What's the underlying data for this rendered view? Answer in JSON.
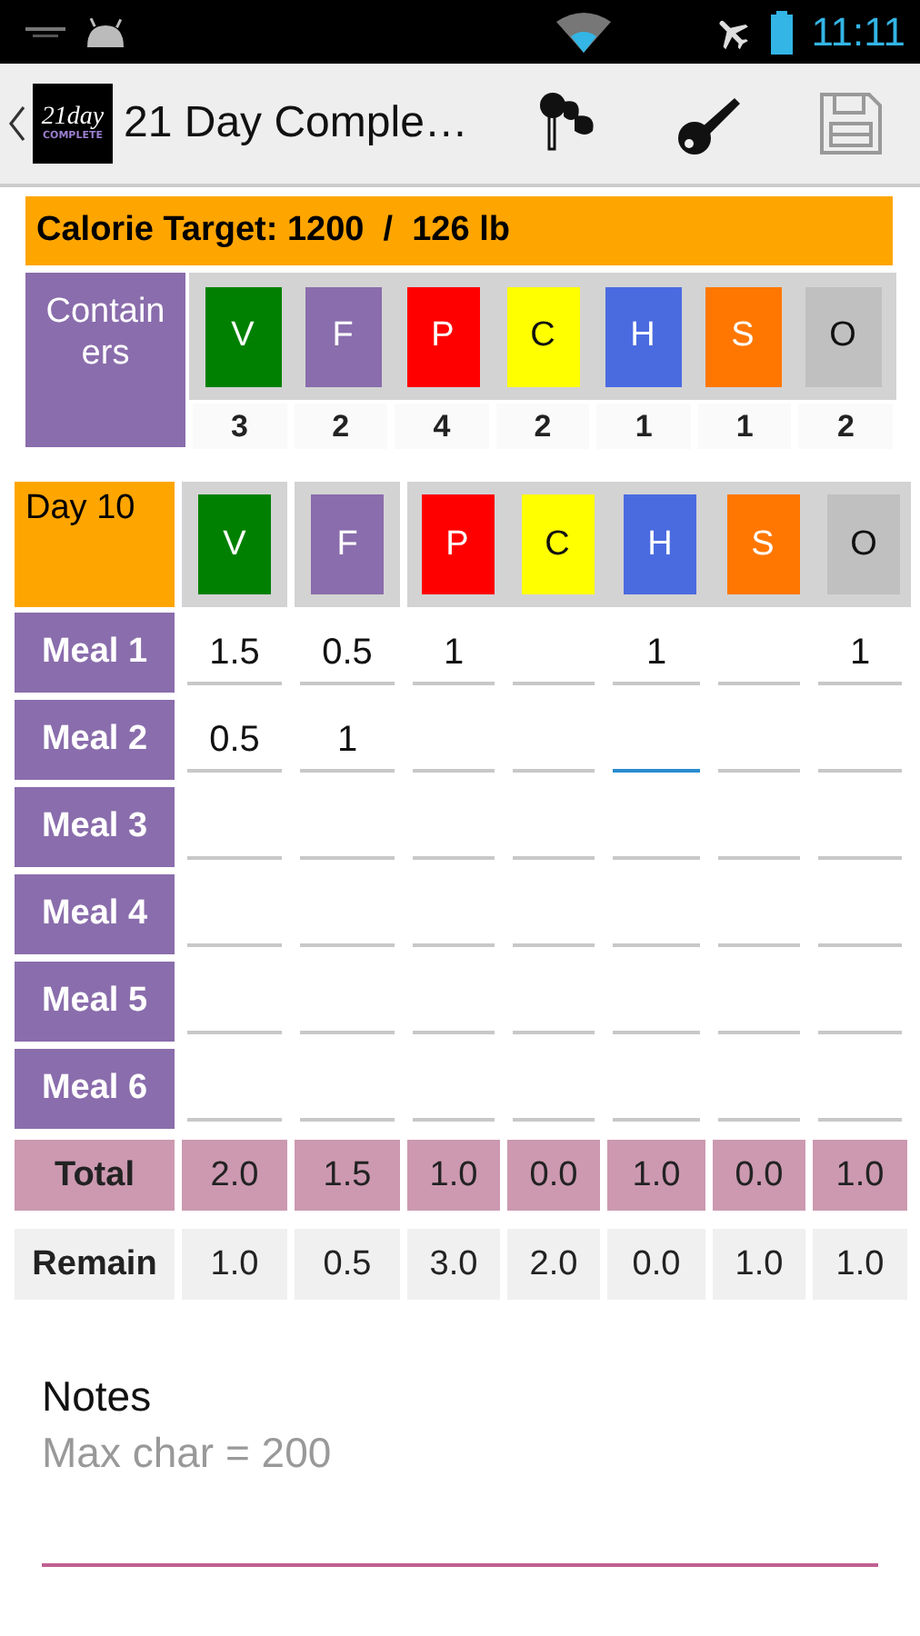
{
  "status_bar": {
    "time": "11:11"
  },
  "action_bar": {
    "logo": {
      "top": "21day",
      "bottom": "COMPLETE"
    },
    "title": "21 Day Comple…"
  },
  "target": {
    "text": "Calorie Target: 1200  /  126 lb"
  },
  "containers": {
    "label": "Containers",
    "items": [
      {
        "letter": "V",
        "color": "#008000",
        "count": "3"
      },
      {
        "letter": "F",
        "color": "#8a6dac",
        "count": "2"
      },
      {
        "letter": "P",
        "color": "#ff0000",
        "count": "4"
      },
      {
        "letter": "C",
        "color": "#ffff00",
        "count": "2"
      },
      {
        "letter": "H",
        "color": "#4a6be0",
        "count": "1"
      },
      {
        "letter": "S",
        "color": "#ff7700",
        "count": "1"
      },
      {
        "letter": "O",
        "color": "#c0c0c0",
        "count": "2"
      }
    ]
  },
  "day": {
    "label": "Day 10",
    "letters": [
      {
        "letter": "V",
        "color": "#008000"
      },
      {
        "letter": "F",
        "color": "#8a6dac"
      },
      {
        "letter": "P",
        "color": "#ff0000"
      },
      {
        "letter": "C",
        "color": "#ffff00"
      },
      {
        "letter": "H",
        "color": "#4a6be0"
      },
      {
        "letter": "S",
        "color": "#ff7700"
      },
      {
        "letter": "O",
        "color": "#c0c0c0"
      }
    ]
  },
  "meals": [
    {
      "label": "Meal 1",
      "cells": [
        {
          "value": "1.5",
          "focused": false
        },
        {
          "value": "0.5",
          "focused": false
        },
        {
          "value": "1",
          "focused": false
        },
        {
          "focused": false
        },
        {
          "value": "1",
          "focused": false
        },
        {
          "focused": false
        },
        {
          "value": "1",
          "focused": false
        }
      ]
    },
    {
      "label": "Meal 2",
      "cells": [
        {
          "value": "0.5",
          "focused": false
        },
        {
          "value": "1",
          "focused": false
        },
        {
          "focused": false
        },
        {
          "focused": false
        },
        {
          "focused": true
        },
        {
          "focused": false
        },
        {
          "focused": false
        }
      ]
    },
    {
      "label": "Meal 3",
      "cells": [
        {
          "focused": false
        },
        {
          "focused": false
        },
        {
          "focused": false
        },
        {
          "focused": false
        },
        {
          "focused": false
        },
        {
          "focused": false
        },
        {
          "focused": false
        }
      ]
    },
    {
      "label": "Meal 4",
      "cells": [
        {
          "focused": false
        },
        {
          "focused": false
        },
        {
          "focused": false
        },
        {
          "focused": false
        },
        {
          "focused": false
        },
        {
          "focused": false
        },
        {
          "focused": false
        }
      ]
    },
    {
      "label": "Meal 5",
      "cells": [
        {
          "focused": false
        },
        {
          "focused": false
        },
        {
          "focused": false
        },
        {
          "focused": false
        },
        {
          "focused": false
        },
        {
          "focused": false
        },
        {
          "focused": false
        }
      ]
    },
    {
      "label": "Meal 6",
      "cells": [
        {
          "focused": false
        },
        {
          "focused": false
        },
        {
          "focused": false
        },
        {
          "focused": false
        },
        {
          "focused": false
        },
        {
          "focused": false
        },
        {
          "focused": false
        }
      ]
    }
  ],
  "summary": [
    {
      "kind": "total",
      "label": "Total",
      "values": [
        "2.0",
        "1.5",
        "1.0",
        "0.0",
        "1.0",
        "0.0",
        "1.0"
      ]
    },
    {
      "kind": "remain",
      "label": "Remain",
      "values": [
        "1.0",
        "0.5",
        "3.0",
        "2.0",
        "0.0",
        "1.0",
        "1.0"
      ]
    }
  ],
  "notes": {
    "label": "Notes",
    "placeholder": "Max char = 200"
  }
}
